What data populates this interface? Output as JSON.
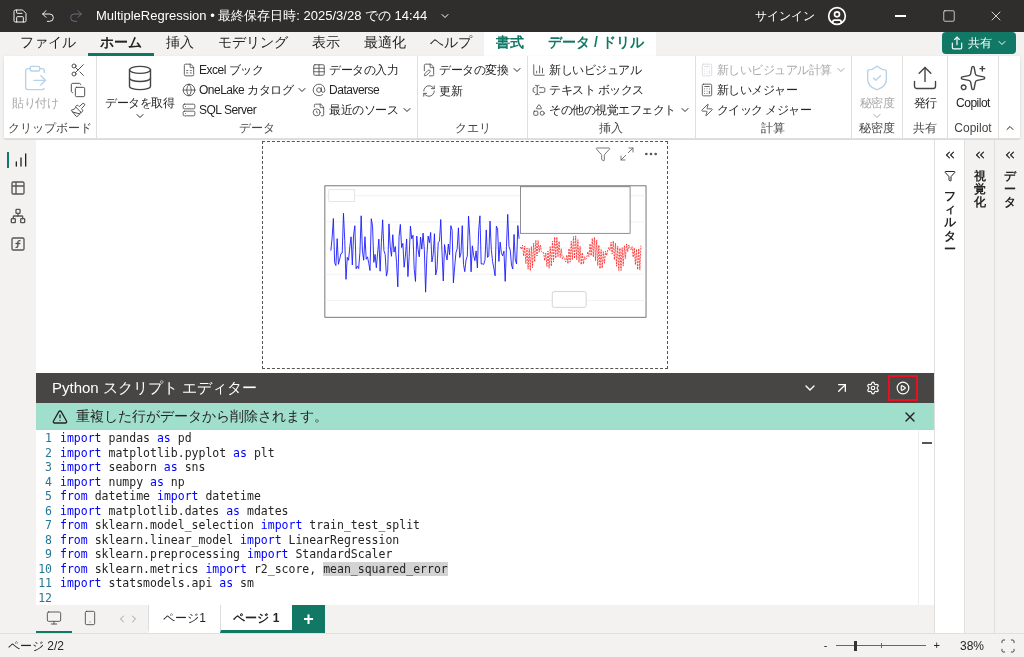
{
  "title_bar": {
    "title": "MultipleRegression • 最終保存日時: 2025/3/28 での 14:44",
    "sign_in": "サインイン"
  },
  "menu_tabs": [
    {
      "label": "ファイル",
      "selected": false,
      "kind": "normal"
    },
    {
      "label": "ホーム",
      "selected": true,
      "kind": "normal"
    },
    {
      "label": "挿入",
      "selected": false,
      "kind": "normal"
    },
    {
      "label": "モデリング",
      "selected": false,
      "kind": "normal"
    },
    {
      "label": "表示",
      "selected": false,
      "kind": "normal"
    },
    {
      "label": "最適化",
      "selected": false,
      "kind": "normal"
    },
    {
      "label": "ヘルプ",
      "selected": false,
      "kind": "normal"
    },
    {
      "label": "書式",
      "selected": false,
      "kind": "context"
    },
    {
      "label": "データ / ドリル",
      "selected": false,
      "kind": "context"
    }
  ],
  "share_button": "共有",
  "ribbon_groups": [
    {
      "label": "クリップボード",
      "columns": [
        [
          {
            "label": "貼り付け",
            "kind": "large",
            "disabled": true,
            "dropdown": false
          }
        ],
        [
          {
            "kind": "icon"
          },
          {
            "kind": "icon"
          },
          {
            "kind": "icon"
          }
        ]
      ]
    },
    {
      "label": "データ",
      "columns": [
        [
          {
            "label": "データを取得",
            "kind": "large",
            "disabled": false,
            "dropdown": true
          }
        ],
        [
          {
            "label": "Excel ブック",
            "kind": "small",
            "disabled": false,
            "dropdown": false
          },
          {
            "label": "OneLake カタログ",
            "kind": "small",
            "disabled": false,
            "dropdown": true
          },
          {
            "label": "SQL Server",
            "kind": "small",
            "disabled": false,
            "dropdown": false
          }
        ],
        [
          {
            "label": "データの入力",
            "kind": "small",
            "disabled": false,
            "dropdown": false
          },
          {
            "label": "Dataverse",
            "kind": "small",
            "disabled": false,
            "dropdown": false
          },
          {
            "label": "最近のソース",
            "kind": "small",
            "disabled": false,
            "dropdown": true
          }
        ]
      ]
    },
    {
      "label": "クエリ",
      "columns": [
        [
          {
            "label": "データの変換",
            "kind": "small",
            "disabled": false,
            "dropdown": true
          },
          {
            "label": "更新",
            "kind": "small",
            "disabled": false,
            "dropdown": false
          }
        ]
      ]
    },
    {
      "label": "挿入",
      "columns": [
        [
          {
            "label": "新しいビジュアル",
            "kind": "small",
            "disabled": false,
            "dropdown": false
          },
          {
            "label": "テキスト ボックス",
            "kind": "small",
            "disabled": false,
            "dropdown": false
          },
          {
            "label": "その他の視覚エフェクト",
            "kind": "small",
            "disabled": false,
            "dropdown": true
          }
        ]
      ]
    },
    {
      "label": "計算",
      "columns": [
        [
          {
            "label": "新しいビジュアル計算",
            "kind": "small",
            "disabled": true,
            "dropdown": true
          },
          {
            "label": "新しいメジャー",
            "kind": "small",
            "disabled": false,
            "dropdown": false
          },
          {
            "label": "クイック メジャー",
            "kind": "small",
            "disabled": false,
            "dropdown": false
          }
        ]
      ]
    },
    {
      "label": "秘密度",
      "columns": [
        [
          {
            "label": "秘密度",
            "kind": "large",
            "disabled": true,
            "dropdown": true
          }
        ]
      ]
    },
    {
      "label": "共有",
      "columns": [
        [
          {
            "label": "発行",
            "kind": "large",
            "disabled": false,
            "dropdown": false
          }
        ]
      ]
    },
    {
      "label": "Copilot",
      "columns": [
        [
          {
            "label": "Copilot",
            "kind": "large",
            "disabled": false,
            "dropdown": false
          }
        ]
      ]
    }
  ],
  "side_panes": [
    {
      "label": "フィルター",
      "kind": "filter"
    },
    {
      "label": "視覚化",
      "kind": "plain"
    },
    {
      "label": "データ",
      "kind": "plain"
    }
  ],
  "editor": {
    "title": "Python スクリプト エディター",
    "banner": "重複した行がデータから削除されます。",
    "lines": [
      {
        "number": "1",
        "tokens": [
          {
            "text": "import",
            "kind": "keyword"
          },
          {
            "text": " pandas ",
            "kind": "plain"
          },
          {
            "text": "as",
            "kind": "keyword"
          },
          {
            "text": " pd",
            "kind": "plain"
          }
        ]
      },
      {
        "number": "2",
        "tokens": [
          {
            "text": "import",
            "kind": "keyword"
          },
          {
            "text": " matplotlib.pyplot ",
            "kind": "plain"
          },
          {
            "text": "as",
            "kind": "keyword"
          },
          {
            "text": " plt",
            "kind": "plain"
          }
        ]
      },
      {
        "number": "3",
        "tokens": [
          {
            "text": "import",
            "kind": "keyword"
          },
          {
            "text": " seaborn ",
            "kind": "plain"
          },
          {
            "text": "as",
            "kind": "keyword"
          },
          {
            "text": " sns",
            "kind": "plain"
          }
        ]
      },
      {
        "number": "4",
        "tokens": [
          {
            "text": "import",
            "kind": "keyword"
          },
          {
            "text": " numpy ",
            "kind": "plain"
          },
          {
            "text": "as",
            "kind": "keyword"
          },
          {
            "text": " np",
            "kind": "plain"
          }
        ]
      },
      {
        "number": "5",
        "tokens": [
          {
            "text": "from",
            "kind": "keyword"
          },
          {
            "text": " datetime ",
            "kind": "plain"
          },
          {
            "text": "import",
            "kind": "keyword"
          },
          {
            "text": " datetime",
            "kind": "plain"
          }
        ]
      },
      {
        "number": "6",
        "tokens": [
          {
            "text": "import",
            "kind": "keyword"
          },
          {
            "text": " matplotlib.dates ",
            "kind": "plain"
          },
          {
            "text": "as",
            "kind": "keyword"
          },
          {
            "text": " mdates",
            "kind": "plain"
          }
        ]
      },
      {
        "number": "7",
        "tokens": [
          {
            "text": "from",
            "kind": "keyword"
          },
          {
            "text": " sklearn.model_selection ",
            "kind": "plain"
          },
          {
            "text": "import",
            "kind": "keyword"
          },
          {
            "text": " train_test_split",
            "kind": "plain"
          }
        ]
      },
      {
        "number": "8",
        "tokens": [
          {
            "text": "from",
            "kind": "keyword"
          },
          {
            "text": " sklearn.linear_model ",
            "kind": "plain"
          },
          {
            "text": "import",
            "kind": "keyword"
          },
          {
            "text": " LinearRegression",
            "kind": "plain"
          }
        ]
      },
      {
        "number": "9",
        "tokens": [
          {
            "text": "from",
            "kind": "keyword"
          },
          {
            "text": " sklearn.preprocessing ",
            "kind": "plain"
          },
          {
            "text": "import",
            "kind": "keyword"
          },
          {
            "text": " StandardScaler",
            "kind": "plain"
          }
        ]
      },
      {
        "number": "10",
        "tokens": [
          {
            "text": "from",
            "kind": "keyword"
          },
          {
            "text": " sklearn.metrics ",
            "kind": "plain"
          },
          {
            "text": "import",
            "kind": "keyword"
          },
          {
            "text": " r2_score, ",
            "kind": "plain"
          },
          {
            "text": "mean_squared_error",
            "kind": "highlight"
          }
        ]
      },
      {
        "number": "11",
        "tokens": [
          {
            "text": "import",
            "kind": "keyword"
          },
          {
            "text": " statsmodels.api ",
            "kind": "plain"
          },
          {
            "text": "as",
            "kind": "keyword"
          },
          {
            "text": " sm",
            "kind": "plain"
          }
        ]
      },
      {
        "number": "12"
      }
    ]
  },
  "view_toggle": [
    {
      "kind": "desktop",
      "selected": true
    },
    {
      "kind": "mobile",
      "selected": false
    }
  ],
  "page_tabs": [
    {
      "label": "ページ1",
      "selected": false
    },
    {
      "label": "ページ 1",
      "selected": true
    }
  ],
  "add_page_button": "+",
  "status_bar": {
    "page": "ページ 2/2",
    "zoom_out": "-",
    "zoom_in": "+",
    "zoom_slider": {
      "level": 0.2
    },
    "zoom": "38%"
  }
}
